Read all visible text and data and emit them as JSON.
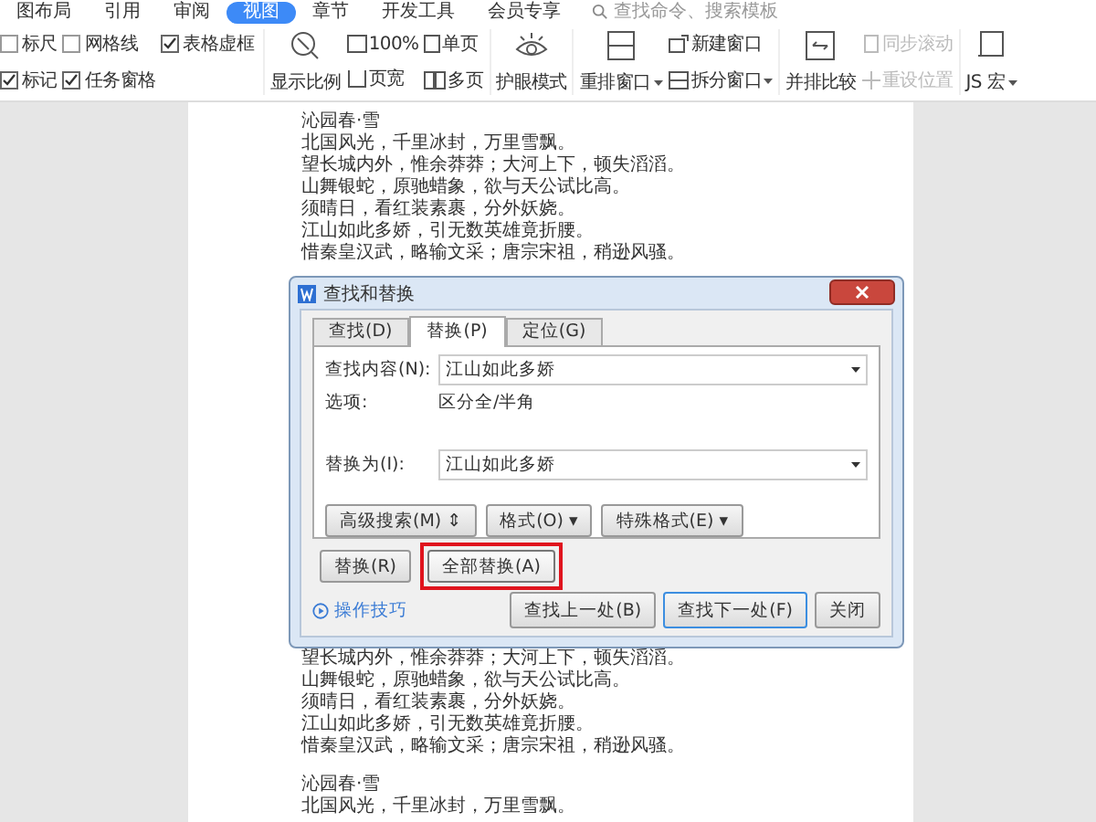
{
  "menu_tabs": [
    {
      "label": "图布局",
      "selected": false
    },
    {
      "label": "引用",
      "selected": false
    },
    {
      "label": "审阅",
      "selected": false
    },
    {
      "label": "视图",
      "selected": true
    },
    {
      "label": "章节",
      "selected": false
    },
    {
      "label": "开发工具",
      "selected": false
    },
    {
      "label": "会员专享",
      "selected": false
    }
  ],
  "search": {
    "placeholder": "查找命令、搜索模板"
  },
  "checkboxes": [
    {
      "label": "标尺",
      "checked": false
    },
    {
      "label": "网格线",
      "checked": false
    },
    {
      "label": "表格虚框",
      "checked": true
    },
    {
      "label": "标记",
      "checked": true
    },
    {
      "label": "任务窗格",
      "checked": true
    }
  ],
  "ribbon": {
    "zoom": "显示比例",
    "zoom_100": "100%",
    "page_width": "页宽",
    "single_page": "单页",
    "multi_page": "多页",
    "eye_mode": "护眼模式",
    "rearrange": "重排窗口",
    "new_window": "新建窗口",
    "split_window": "拆分窗口",
    "side_by_side": "并排比较",
    "sync_scroll": {
      "label": "同步滚动",
      "disabled": true
    },
    "reset_position": {
      "label": "重设位置",
      "disabled": true
    },
    "macro": "JS 宏"
  },
  "document": {
    "blocks": [
      {
        "title": "沁园春·雪",
        "lines": [
          "北国风光，千里冰封，万里雪飘。",
          "望长城内外，惟余莽莽；大河上下，顿失滔滔。",
          "山舞银蛇，原驰蜡象，欲与天公试比高。",
          "须晴日，看红装素裹，分外妖娆。",
          "江山如此多娇，引无数英雄竟折腰。",
          "惜秦皇汉武，略输文采；唐宗宋祖，稍逊风骚。"
        ]
      },
      {
        "lines": [
          "望长城内外，惟余莽莽；大河上下，顿失滔滔。",
          "山舞银蛇，原驰蜡象，欲与天公试比高。",
          "须晴日，看红装素裹，分外妖娆。",
          "江山如此多娇，引无数英雄竟折腰。",
          "惜秦皇汉武，略输文采；唐宗宋祖，稍逊风骚。"
        ]
      },
      {
        "title": "沁园春·雪",
        "lines": [
          "北国风光，千里冰封，万里雪飘。"
        ]
      }
    ]
  },
  "dialog": {
    "title": "查找和替换",
    "tabs": [
      {
        "label": "查找(D)",
        "selected": false
      },
      {
        "label": "替换(P)",
        "selected": true
      },
      {
        "label": "定位(G)",
        "selected": false
      }
    ],
    "find_label": "查找内容(N):",
    "find_value": "江山如此多娇",
    "options_label": "选项:",
    "options_value": "区分全/半角",
    "replace_label": "替换为(I):",
    "replace_value": "江山如此多娇",
    "option_buttons": [
      "高级搜索(M) ⇕",
      "格式(O) ▾",
      "特殊格式(E) ▾"
    ],
    "action_buttons": [
      {
        "label": "替换(R)",
        "highlighted": false
      },
      {
        "label": "全部替换(A)",
        "highlighted": true
      }
    ],
    "tips_link": "操作技巧",
    "footer_buttons": [
      {
        "label": "查找上一处(B)",
        "default": false
      },
      {
        "label": "查找下一处(F)",
        "default": true
      },
      {
        "label": "关闭",
        "default": false
      }
    ]
  }
}
